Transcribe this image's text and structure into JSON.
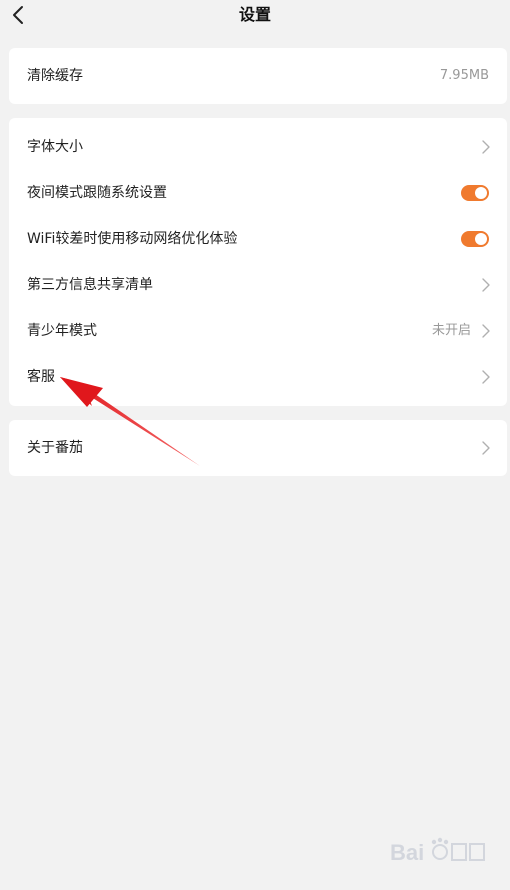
{
  "header": {
    "back_icon": "chevron-left-icon",
    "title": "设置"
  },
  "cache_card": {
    "label": "清除缓存",
    "value": "7.95MB"
  },
  "settings_card": {
    "items": [
      {
        "label": "字体大小",
        "control": "chevron"
      },
      {
        "label": "夜间模式跟随系统设置",
        "control": "toggle",
        "on": true
      },
      {
        "label": "WiFi较差时使用移动网络优化体验",
        "control": "toggle",
        "on": true
      },
      {
        "label": "第三方信息共享清单",
        "control": "chevron"
      },
      {
        "label": "青少年模式",
        "value": "未开启",
        "control": "chevron"
      },
      {
        "label": "客服",
        "control": "chevron"
      }
    ]
  },
  "about_card": {
    "label": "关于番茄",
    "control": "chevron"
  },
  "colors": {
    "accent": "#f07a2e",
    "background": "#f2f2f2",
    "card": "#ffffff",
    "annotation_arrow": "#e8262a"
  },
  "annotation": {
    "type": "red-arrow",
    "points_to": "客服"
  },
  "watermark": {
    "type": "Baidu 经验 logo"
  }
}
